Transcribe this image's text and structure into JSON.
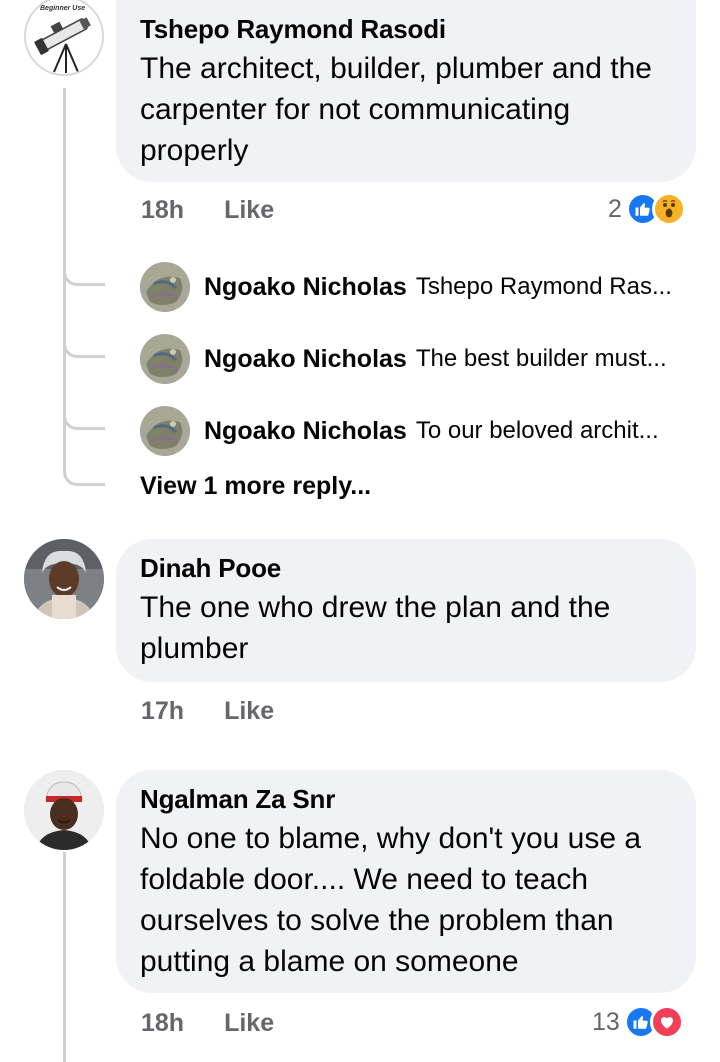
{
  "comments": [
    {
      "author": "Tshepo Raymond Rasodi",
      "text": "The architect, builder, plumber and the carpenter for not communicating properly",
      "time": "18h",
      "like_label": "Like",
      "reaction_count": "2",
      "reactions": [
        "like-icon",
        "wow-icon"
      ],
      "avatar_badge": "Beginner Use",
      "replies": [
        {
          "author": "Ngoako Nicholas",
          "preview": "Tshepo Raymond Ras..."
        },
        {
          "author": "Ngoako Nicholas",
          "preview": "The best builder must..."
        },
        {
          "author": "Ngoako Nicholas",
          "preview": "To our beloved archit..."
        }
      ],
      "view_more": "View 1 more reply..."
    },
    {
      "author": "Dinah Pooe",
      "text": "The one who drew the plan and the plumber",
      "time": "17h",
      "like_label": "Like"
    },
    {
      "author": "Ngalman Za Snr",
      "text": "No one to blame, why don't you use a foldable door.... We need to teach ourselves to solve the problem than putting a blame on someone",
      "time": "18h",
      "like_label": "Like",
      "reaction_count": "13",
      "reactions": [
        "like-icon",
        "love-icon"
      ]
    }
  ],
  "colors": {
    "bubble": "#f0f2f5",
    "meta_text": "#65676b",
    "like_blue": "#1877f2",
    "love_red": "#f33e58",
    "wow_yellow": "#f7b125",
    "thread_line": "#ced0d4"
  }
}
